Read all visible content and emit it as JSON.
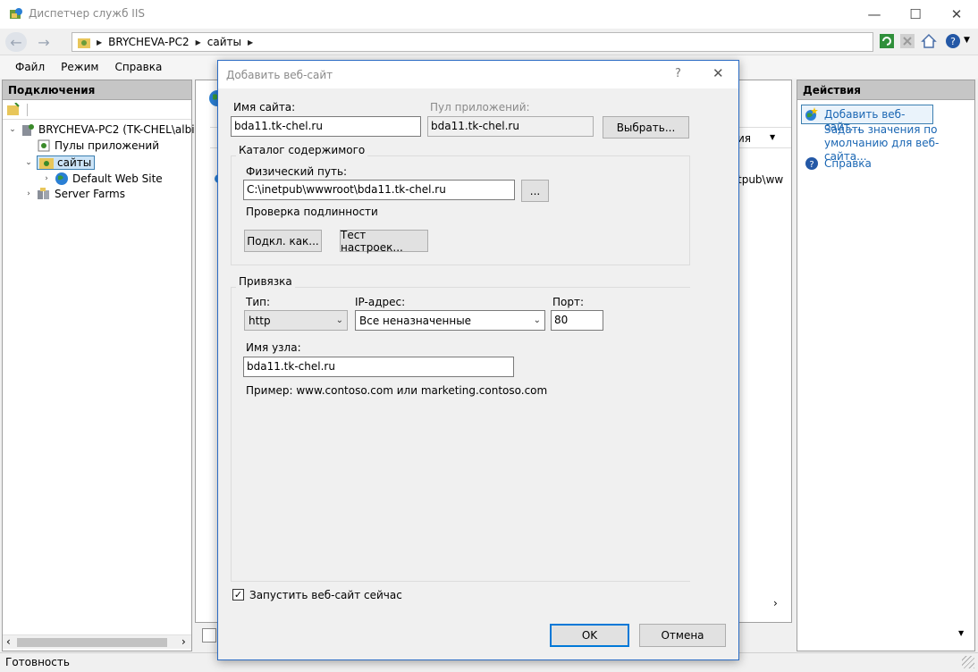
{
  "window": {
    "title": "Диспетчер служб IIS"
  },
  "address": {
    "crumbs": [
      "BRYCHEVA-PC2",
      "сайты"
    ]
  },
  "menu": [
    "Файл",
    "Режим",
    "Справка"
  ],
  "connections": {
    "header": "Подключения",
    "tree": [
      {
        "label": "BRYCHEVA-PC2 (TK-CHEL\\albin"
      },
      {
        "label": "Пулы приложений"
      },
      {
        "label": "сайты"
      },
      {
        "label": "Default Web Site"
      },
      {
        "label": "Server Farms"
      }
    ]
  },
  "center": {
    "column_fragment": "ия",
    "path_fragment": "tpub\\ww"
  },
  "actions": {
    "header": "Действия",
    "items": [
      "Добавить веб-сайт...",
      "Задать значения по умолчанию для веб-сайта...",
      "Справка"
    ]
  },
  "status": "Готовность",
  "dialog": {
    "title": "Добавить веб-сайт",
    "help": "?",
    "site_name_label": "Имя сайта:",
    "site_name": "bda11.tk-chel.ru",
    "app_pool_label": "Пул приложений:",
    "app_pool": "bda11.tk-chel.ru",
    "select_button": "Выбрать...",
    "content_group": "Каталог содержимого",
    "physical_path_label": "Физический путь:",
    "physical_path": "C:\\inetpub\\wwwroot\\bda11.tk-chel.ru",
    "browse_button": "...",
    "auth_label": "Проверка подлинности",
    "connect_as_button": "Подкл. как...",
    "test_settings_button": "Тест настроек...",
    "binding_group": "Привязка",
    "type_label": "Тип:",
    "type_value": "http",
    "ip_label": "IP-адрес:",
    "ip_value": "Все неназначенные",
    "port_label": "Порт:",
    "port_value": "80",
    "host_label": "Имя узла:",
    "host_value": "bda11.tk-chel.ru",
    "example": "Пример: www.contoso.com или marketing.contoso.com",
    "start_now_label": "Запустить веб-сайт сейчас",
    "start_now_checked": true,
    "ok_button": "OK",
    "cancel_button": "Отмена"
  }
}
